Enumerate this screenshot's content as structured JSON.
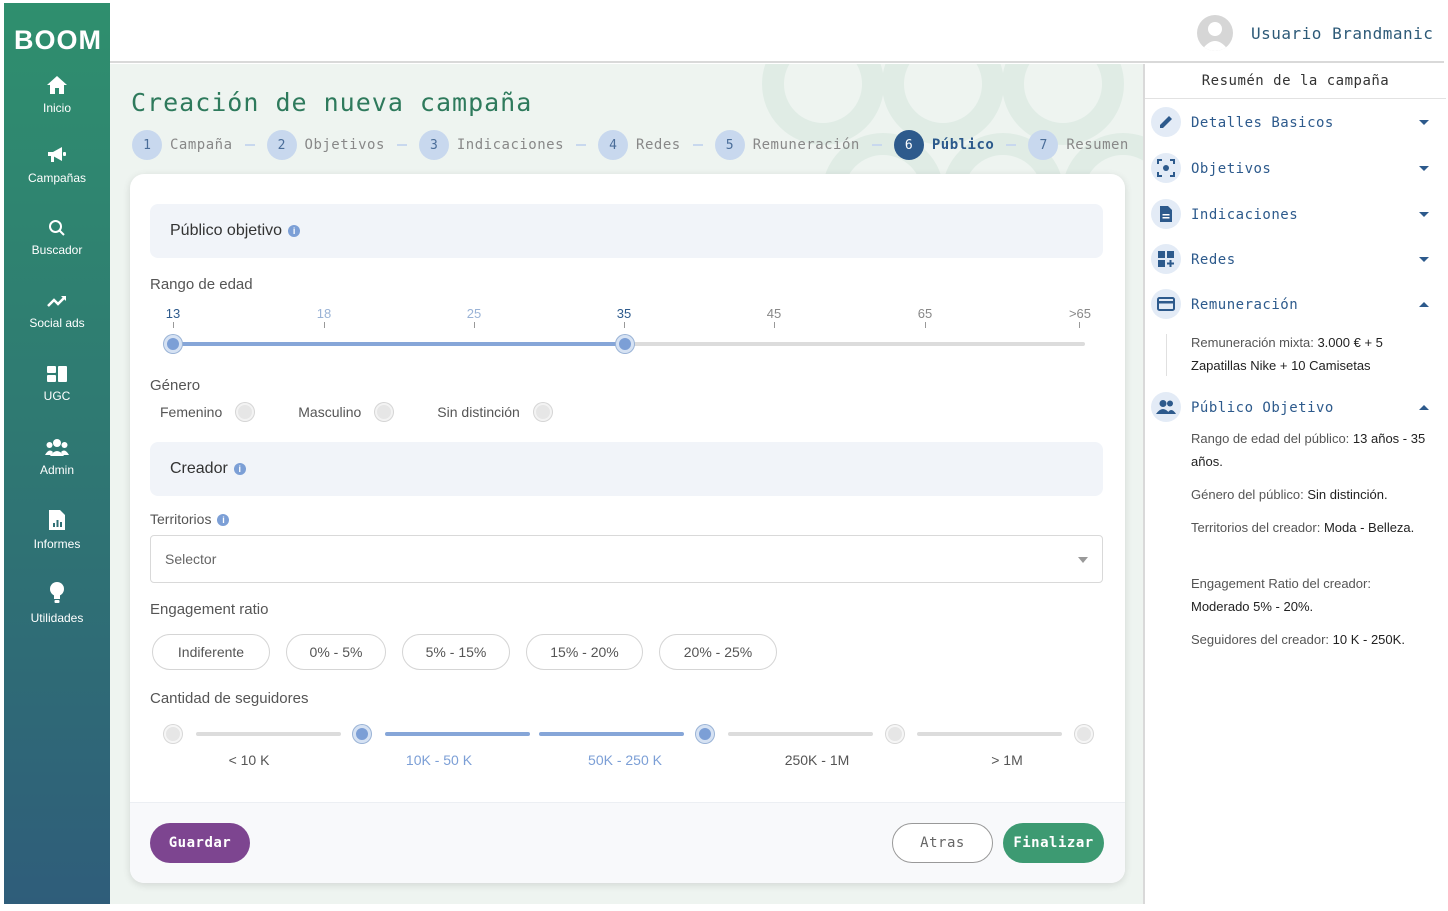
{
  "brand": {
    "logo": "BOOM"
  },
  "nav": [
    {
      "label": "Inicio",
      "icon": "home-icon"
    },
    {
      "label": "Campañas",
      "icon": "megaphone-icon"
    },
    {
      "label": "Buscador",
      "icon": "search-icon"
    },
    {
      "label": "Social ads",
      "icon": "trending-up-icon"
    },
    {
      "label": "UGC",
      "icon": "grid-icon"
    },
    {
      "label": "Admin",
      "icon": "group-icon"
    },
    {
      "label": "Informes",
      "icon": "report-icon"
    },
    {
      "label": "Utilidades",
      "icon": "lightbulb-icon"
    }
  ],
  "header": {
    "username": "Usuario Brandmanic"
  },
  "page": {
    "title": "Creación de nueva campaña",
    "steps": [
      {
        "num": "1",
        "label": "Campaña"
      },
      {
        "num": "2",
        "label": "Objetivos"
      },
      {
        "num": "3",
        "label": "Indicaciones"
      },
      {
        "num": "4",
        "label": "Redes"
      },
      {
        "num": "5",
        "label": "Remuneración"
      },
      {
        "num": "6",
        "label": "Público",
        "active": true
      },
      {
        "num": "7",
        "label": "Resumen"
      }
    ]
  },
  "form": {
    "audience_title": "Público objetivo",
    "age_label": "Rango de edad",
    "age_ticks": [
      "13",
      "18",
      "25",
      "35",
      "45",
      "65",
      ">65"
    ],
    "age_selected": [
      "13",
      "35"
    ],
    "gender_label": "Género",
    "gender_options": [
      "Femenino",
      "Masculino",
      "Sin distinción"
    ],
    "creator_title": "Creador",
    "territories_label": "Territorios",
    "territories_placeholder": "Selector",
    "engagement_label": "Engagement ratio",
    "engagement_options": [
      "Indiferente",
      "0% - 5%",
      "5% - 15%",
      "15% - 20%",
      "20% - 25%"
    ],
    "followers_label": "Cantidad de seguidores",
    "followers_ranges": [
      "< 10 K",
      "10K - 50 K",
      "50K - 250 K",
      "250K - 1M",
      "> 1M"
    ],
    "followers_selected": [
      "10K - 50 K",
      "50K - 250 K"
    ]
  },
  "footer": {
    "save": "Guardar",
    "back": "Atras",
    "finish": "Finalizar"
  },
  "summary": {
    "title": "Resumén de la campaña",
    "sections": [
      {
        "label": "Detalles Basicos",
        "icon": "pencil-icon",
        "expanded": false
      },
      {
        "label": "Objetivos",
        "icon": "focus-icon",
        "expanded": false
      },
      {
        "label": "Indicaciones",
        "icon": "document-icon",
        "expanded": false
      },
      {
        "label": "Redes",
        "icon": "widgets-icon",
        "expanded": false
      },
      {
        "label": "Remuneración",
        "icon": "credit-card-icon",
        "expanded": true
      },
      {
        "label": "Público Objetivo",
        "icon": "people-icon",
        "expanded": true
      }
    ],
    "remuneration": {
      "k": "Remuneración mixta: ",
      "v": "3.000 € + 5 Zapatillas Nike + 10 Camisetas"
    },
    "audience": [
      {
        "k": "Rango de edad del público: ",
        "v": "13 años - 35 años."
      },
      {
        "k": "Género del público: ",
        "v": "Sin distinción."
      },
      {
        "k": "Territorios del creador: ",
        "v": "Moda - Belleza."
      },
      {
        "k": "Engagement Ratio del creador: ",
        "v": "Moderado 5% - 20%."
      },
      {
        "k": "Seguidores del creador: ",
        "v": "10 K - 250K."
      }
    ]
  },
  "colors": {
    "primary": "#2d5a8c",
    "green": "#3d9a72",
    "purple": "#7d4590",
    "sidebar_top": "#2f8f6e",
    "sidebar_bottom": "#2f5d7a"
  }
}
